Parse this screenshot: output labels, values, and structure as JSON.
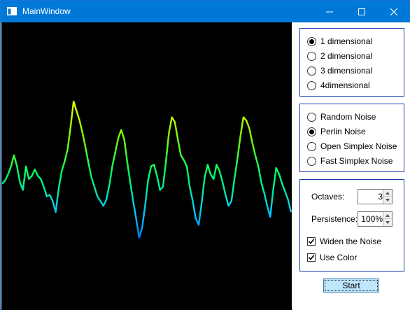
{
  "window": {
    "title": "MainWindow",
    "titlebar_color": "#0078d7"
  },
  "caption_buttons": {
    "minimize_icon": "minimize-icon",
    "maximize_icon": "maximize-icon",
    "close_icon": "close-icon"
  },
  "dimension_group": {
    "options": [
      {
        "label": "1 dimensional",
        "selected": true
      },
      {
        "label": "2 dimensional",
        "selected": false
      },
      {
        "label": "3 dimensional",
        "selected": false
      },
      {
        "label": "4dimensional",
        "selected": false
      }
    ]
  },
  "noise_group": {
    "options": [
      {
        "label": "Random Noise",
        "selected": false
      },
      {
        "label": "Perlin Noise",
        "selected": true
      },
      {
        "label": "Open Simplex Noise",
        "selected": false
      },
      {
        "label": "Fast Simplex Noise",
        "selected": false
      }
    ]
  },
  "settings_group": {
    "octaves_label": "Octaves:",
    "octaves_value": "3",
    "persistence_label": "Persistence:",
    "persistence_value": "100%",
    "widen_label": "Widen the Noise",
    "widen_checked": true,
    "color_label": "Use Color",
    "color_checked": true
  },
  "start_button": {
    "label": "Start"
  },
  "noise_plot": {
    "background": "#000000",
    "gradient": [
      "#ffff00",
      "#80ff00",
      "#00ff66",
      "#00c8ff",
      "#0050ff"
    ],
    "samples": [
      0.44,
      0.46,
      0.5,
      0.55,
      0.62,
      0.55,
      0.45,
      0.4,
      0.55,
      0.47,
      0.49,
      0.53,
      0.49,
      0.47,
      0.42,
      0.36,
      0.37,
      0.33,
      0.26,
      0.41,
      0.52,
      0.58,
      0.66,
      0.8,
      0.96,
      0.9,
      0.84,
      0.76,
      0.67,
      0.57,
      0.48,
      0.42,
      0.36,
      0.33,
      0.3,
      0.34,
      0.43,
      0.55,
      0.64,
      0.73,
      0.78,
      0.72,
      0.58,
      0.45,
      0.33,
      0.22,
      0.1,
      0.16,
      0.3,
      0.46,
      0.55,
      0.56,
      0.49,
      0.4,
      0.42,
      0.58,
      0.76,
      0.86,
      0.83,
      0.72,
      0.62,
      0.59,
      0.55,
      0.42,
      0.33,
      0.22,
      0.18,
      0.32,
      0.48,
      0.56,
      0.5,
      0.47,
      0.56,
      0.52,
      0.45,
      0.37,
      0.3,
      0.33,
      0.47,
      0.6,
      0.74,
      0.86,
      0.84,
      0.79,
      0.7,
      0.62,
      0.55,
      0.45,
      0.38,
      0.3,
      0.23,
      0.4,
      0.54,
      0.5,
      0.44,
      0.39,
      0.34,
      0.26
    ]
  }
}
